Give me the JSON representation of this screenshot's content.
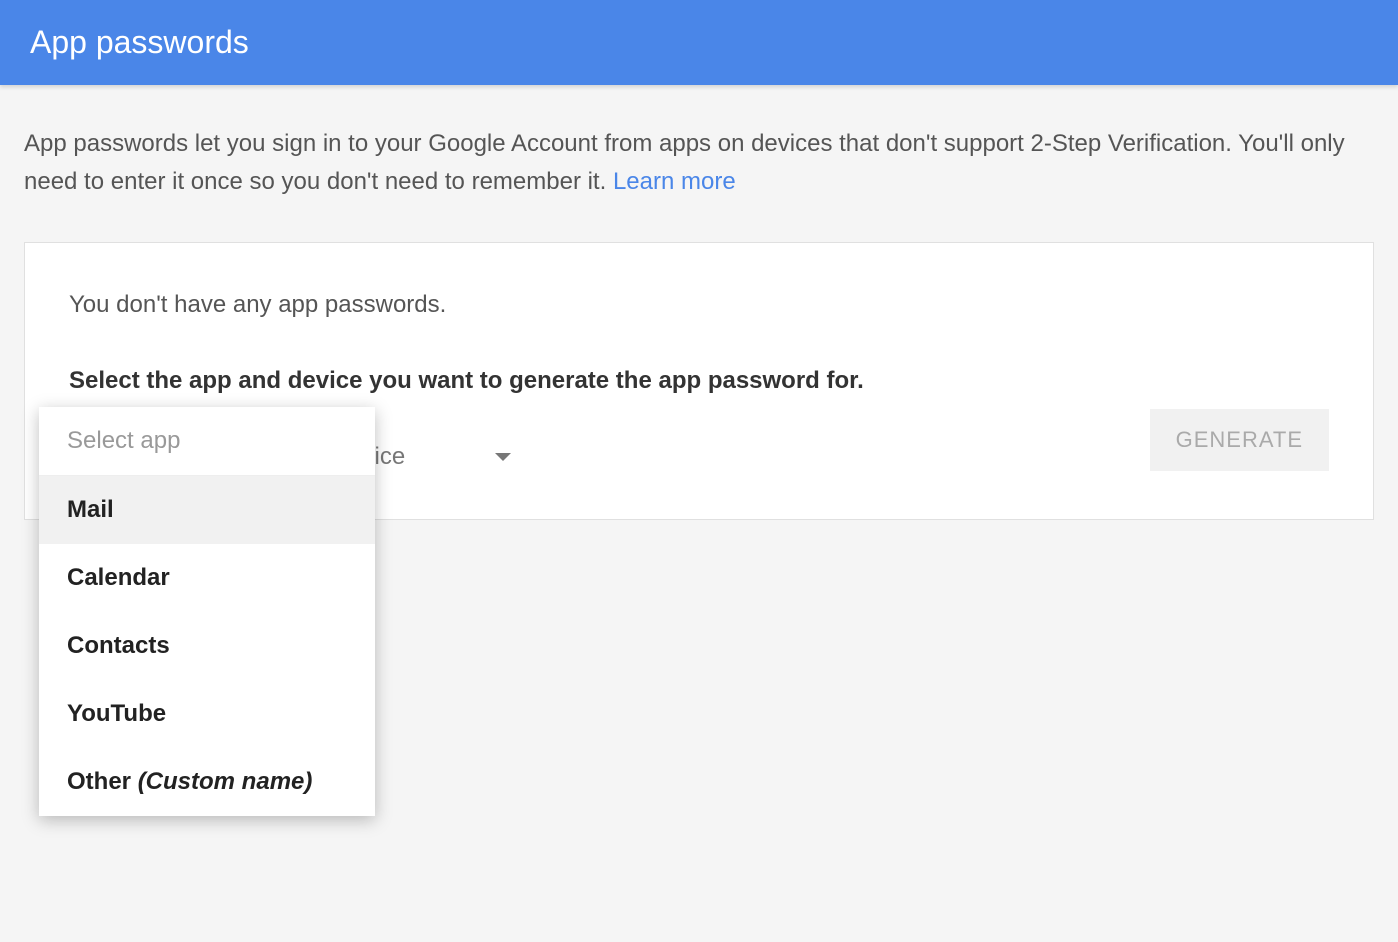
{
  "header": {
    "title": "App passwords"
  },
  "description": {
    "text": "App passwords let you sign in to your Google Account from apps on devices that don't support 2-Step Verification. You'll only need to enter it once so you don't need to remember it. ",
    "learn_more": "Learn more"
  },
  "card": {
    "no_passwords": "You don't have any app passwords.",
    "instruction": "Select the app and device you want to generate the app password for.",
    "select_app": {
      "label": "Select app",
      "options": [
        {
          "label": "Mail",
          "highlighted": true
        },
        {
          "label": "Calendar",
          "highlighted": false
        },
        {
          "label": "Contacts",
          "highlighted": false
        },
        {
          "label": "YouTube",
          "highlighted": false
        }
      ],
      "other_prefix": "Other ",
      "other_suffix": "(Custom name)"
    },
    "select_device": {
      "label": "Select device"
    },
    "generate_button": "GENERATE"
  }
}
